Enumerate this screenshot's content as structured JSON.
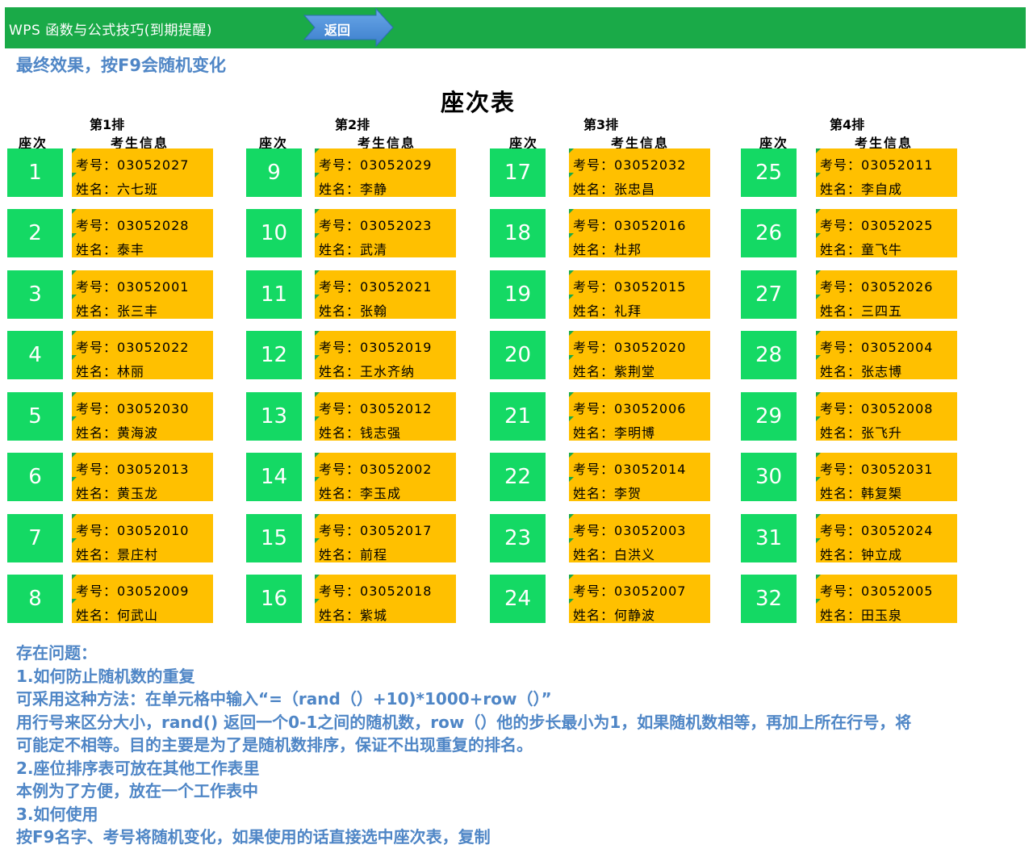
{
  "header": {
    "title": "WPS  函数与公式技巧(到期提醒)",
    "back_label": "返回"
  },
  "subtitle": "最终效果，按F9会随机变化",
  "sheet_title": "座次表",
  "col_heads": {
    "seat": "座次",
    "info": "考生信息"
  },
  "labels": {
    "id": "考号：",
    "name": "姓名："
  },
  "colors": {
    "header": "#1aaa48",
    "seat": "#14d964",
    "info": "#ffc000",
    "notes": "#4f86c6",
    "arrow": "#4a90d9"
  },
  "rows": [
    {
      "label": "第1排",
      "seats": [
        {
          "no": "1",
          "id": "03052027",
          "name": "六七班"
        },
        {
          "no": "2",
          "id": "03052028",
          "name": "泰丰"
        },
        {
          "no": "3",
          "id": "03052001",
          "name": "张三丰"
        },
        {
          "no": "4",
          "id": "03052022",
          "name": "林丽"
        },
        {
          "no": "5",
          "id": "03052030",
          "name": "黄海波"
        },
        {
          "no": "6",
          "id": "03052013",
          "name": "黄玉龙"
        },
        {
          "no": "7",
          "id": "03052010",
          "name": "景庄村"
        },
        {
          "no": "8",
          "id": "03052009",
          "name": "何武山"
        }
      ]
    },
    {
      "label": "第2排",
      "seats": [
        {
          "no": "9",
          "id": "03052029",
          "name": "李静"
        },
        {
          "no": "10",
          "id": "03052023",
          "name": "武清"
        },
        {
          "no": "11",
          "id": "03052021",
          "name": "张翰"
        },
        {
          "no": "12",
          "id": "03052019",
          "name": "王水齐纳"
        },
        {
          "no": "13",
          "id": "03052012",
          "name": "钱志强"
        },
        {
          "no": "14",
          "id": "03052002",
          "name": "李玉成"
        },
        {
          "no": "15",
          "id": "03052017",
          "name": "前程"
        },
        {
          "no": "16",
          "id": "03052018",
          "name": "紫城"
        }
      ]
    },
    {
      "label": "第3排",
      "seats": [
        {
          "no": "17",
          "id": "03052032",
          "name": "张忠昌"
        },
        {
          "no": "18",
          "id": "03052016",
          "name": "杜邦"
        },
        {
          "no": "19",
          "id": "03052015",
          "name": "礼拜"
        },
        {
          "no": "20",
          "id": "03052020",
          "name": "紫荆堂"
        },
        {
          "no": "21",
          "id": "03052006",
          "name": "李明博"
        },
        {
          "no": "22",
          "id": "03052014",
          "name": "李贺"
        },
        {
          "no": "23",
          "id": "03052003",
          "name": "白洪义"
        },
        {
          "no": "24",
          "id": "03052007",
          "name": "何静波"
        }
      ]
    },
    {
      "label": "第4排",
      "seats": [
        {
          "no": "25",
          "id": "03052011",
          "name": "李自成"
        },
        {
          "no": "26",
          "id": "03052025",
          "name": "童飞牛"
        },
        {
          "no": "27",
          "id": "03052026",
          "name": "三四五"
        },
        {
          "no": "28",
          "id": "03052004",
          "name": "张志博"
        },
        {
          "no": "29",
          "id": "03052008",
          "name": "张飞升"
        },
        {
          "no": "30",
          "id": "03052031",
          "name": "韩复榘"
        },
        {
          "no": "31",
          "id": "03052024",
          "name": "钟立成"
        },
        {
          "no": "32",
          "id": "03052005",
          "name": "田玉泉"
        }
      ]
    }
  ],
  "notes": [
    "存在问题：",
    "1.如何防止随机数的重复",
    "可采用这种方法：在单元格中输入“=（rand（）+10)*1000+row（）”",
    "用行号来区分大小，rand() 返回一个0-1之间的随机数，row（）他的步长最小为1，如果随机数相等，再加上所在行号，将",
    "可能定不相等。目的主要是为了是随机数排序，保证不出现重复的排名。",
    "2.座位排序表可放在其他工作表里",
    "本例为了方便，放在一个工作表中",
    "3.如何使用",
    "按F9名字、考号将随机变化，如果使用的话直接选中座次表，复制"
  ]
}
